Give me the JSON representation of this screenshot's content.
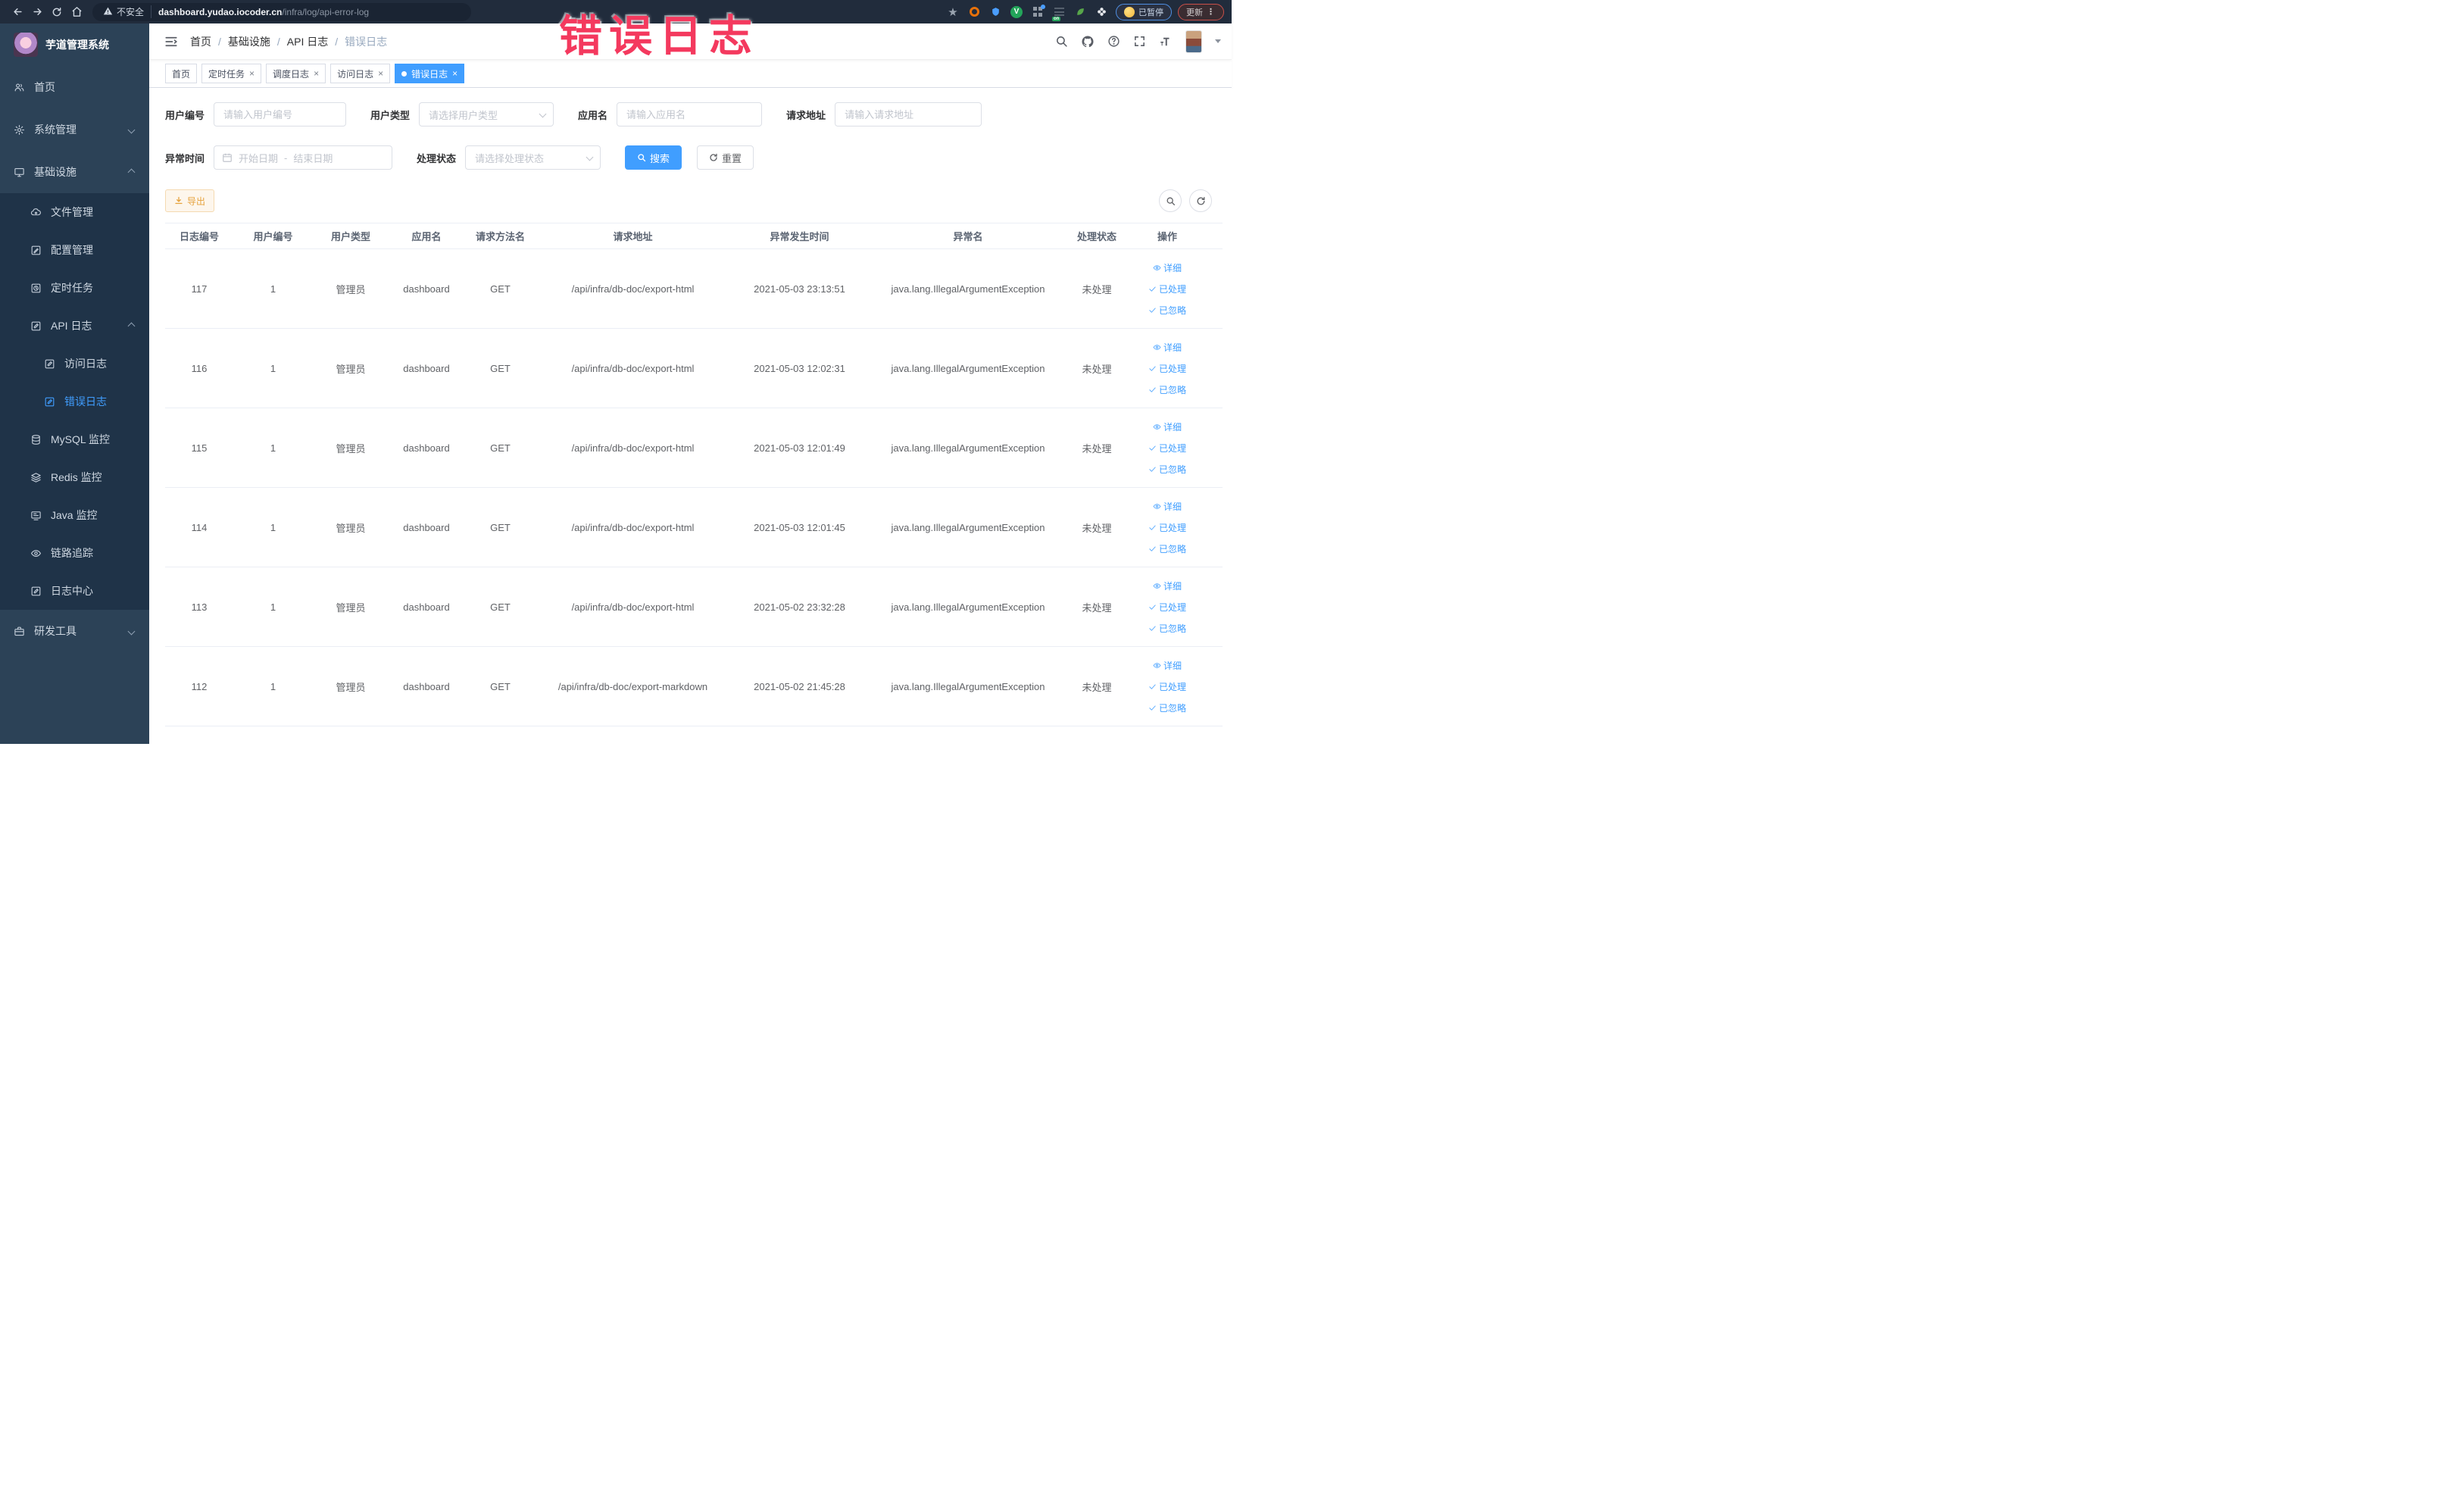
{
  "annotation": {
    "text": "错误日志",
    "color": "#f4395e"
  },
  "browser": {
    "security_label": "不安全",
    "url_host": "dashboard.yudao.iocoder.cn",
    "url_path": "/infra/log/api-error-log",
    "ext_badge": "on",
    "paused_label": "已暂停",
    "update_label": "更新"
  },
  "sidebar": {
    "title": "芋道管理系统",
    "items": [
      {
        "name": "home",
        "label": "首页",
        "icon": "people-icon",
        "level": 1
      },
      {
        "name": "system",
        "label": "系统管理",
        "icon": "gear-icon",
        "level": 1,
        "expand": "down"
      },
      {
        "name": "infra",
        "label": "基础设施",
        "icon": "monitor-icon",
        "level": 1,
        "expand": "up"
      },
      {
        "name": "file",
        "label": "文件管理",
        "icon": "cloud-icon",
        "level": 2
      },
      {
        "name": "config",
        "label": "配置管理",
        "icon": "edit-icon",
        "level": 2
      },
      {
        "name": "job",
        "label": "定时任务",
        "icon": "clock-icon",
        "level": 2
      },
      {
        "name": "api-log",
        "label": "API 日志",
        "icon": "doc-edit-icon",
        "level": 2,
        "expand": "up"
      },
      {
        "name": "access-log",
        "label": "访问日志",
        "icon": "doc-edit-icon",
        "level": 3
      },
      {
        "name": "error-log",
        "label": "错误日志",
        "icon": "doc-edit-icon",
        "level": 3,
        "active": true
      },
      {
        "name": "mysql",
        "label": "MySQL 监控",
        "icon": "database-icon",
        "level": 2
      },
      {
        "name": "redis",
        "label": "Redis 监控",
        "icon": "layers-icon",
        "level": 2
      },
      {
        "name": "java",
        "label": "Java 监控",
        "icon": "screen-icon",
        "level": 2
      },
      {
        "name": "trace",
        "label": "链路追踪",
        "icon": "eye-icon",
        "level": 2
      },
      {
        "name": "log-center",
        "label": "日志中心",
        "icon": "doc-edit-icon",
        "level": 2
      },
      {
        "name": "dev-tools",
        "label": "研发工具",
        "icon": "briefcase-icon",
        "level": 1,
        "expand": "down"
      }
    ]
  },
  "breadcrumb": [
    "首页",
    "基础设施",
    "API 日志",
    "错误日志"
  ],
  "tabs": [
    {
      "label": "首页",
      "closable": false,
      "active": false
    },
    {
      "label": "定时任务",
      "closable": true,
      "active": false
    },
    {
      "label": "调度日志",
      "closable": true,
      "active": false
    },
    {
      "label": "访问日志",
      "closable": true,
      "active": false
    },
    {
      "label": "错误日志",
      "closable": true,
      "active": true
    }
  ],
  "filters": {
    "user_id_label": "用户编号",
    "user_id_placeholder": "请输入用户编号",
    "user_type_label": "用户类型",
    "user_type_placeholder": "请选择用户类型",
    "app_label": "应用名",
    "app_placeholder": "请输入应用名",
    "url_label": "请求地址",
    "url_placeholder": "请输入请求地址",
    "time_label": "异常时间",
    "start_placeholder": "开始日期",
    "separator": "-",
    "end_placeholder": "结束日期",
    "status_label": "处理状态",
    "status_placeholder": "请选择处理状态",
    "search_label": "搜索",
    "reset_label": "重置"
  },
  "toolbar": {
    "export_label": "导出"
  },
  "table": {
    "columns": [
      "日志编号",
      "用户编号",
      "用户类型",
      "应用名",
      "请求方法名",
      "请求地址",
      "异常发生时间",
      "异常名",
      "处理状态",
      "操作"
    ],
    "actions": [
      "详细",
      "已处理",
      "已忽略"
    ],
    "rows": [
      {
        "id": "117",
        "user_id": "1",
        "user_type": "管理员",
        "app": "dashboard",
        "method": "GET",
        "url": "/api/infra/db-doc/export-html",
        "time": "2021-05-03 23:13:51",
        "exception": "java.lang.IllegalArgumentException",
        "status": "未处理"
      },
      {
        "id": "116",
        "user_id": "1",
        "user_type": "管理员",
        "app": "dashboard",
        "method": "GET",
        "url": "/api/infra/db-doc/export-html",
        "time": "2021-05-03 12:02:31",
        "exception": "java.lang.IllegalArgumentException",
        "status": "未处理"
      },
      {
        "id": "115",
        "user_id": "1",
        "user_type": "管理员",
        "app": "dashboard",
        "method": "GET",
        "url": "/api/infra/db-doc/export-html",
        "time": "2021-05-03 12:01:49",
        "exception": "java.lang.IllegalArgumentException",
        "status": "未处理"
      },
      {
        "id": "114",
        "user_id": "1",
        "user_type": "管理员",
        "app": "dashboard",
        "method": "GET",
        "url": "/api/infra/db-doc/export-html",
        "time": "2021-05-03 12:01:45",
        "exception": "java.lang.IllegalArgumentException",
        "status": "未处理"
      },
      {
        "id": "113",
        "user_id": "1",
        "user_type": "管理员",
        "app": "dashboard",
        "method": "GET",
        "url": "/api/infra/db-doc/export-html",
        "time": "2021-05-02 23:32:28",
        "exception": "java.lang.IllegalArgumentException",
        "status": "未处理"
      },
      {
        "id": "112",
        "user_id": "1",
        "user_type": "管理员",
        "app": "dashboard",
        "method": "GET",
        "url": "/api/infra/db-doc/export-markdown",
        "time": "2021-05-02 21:45:28",
        "exception": "java.lang.IllegalArgumentException",
        "status": "未处理"
      }
    ]
  }
}
